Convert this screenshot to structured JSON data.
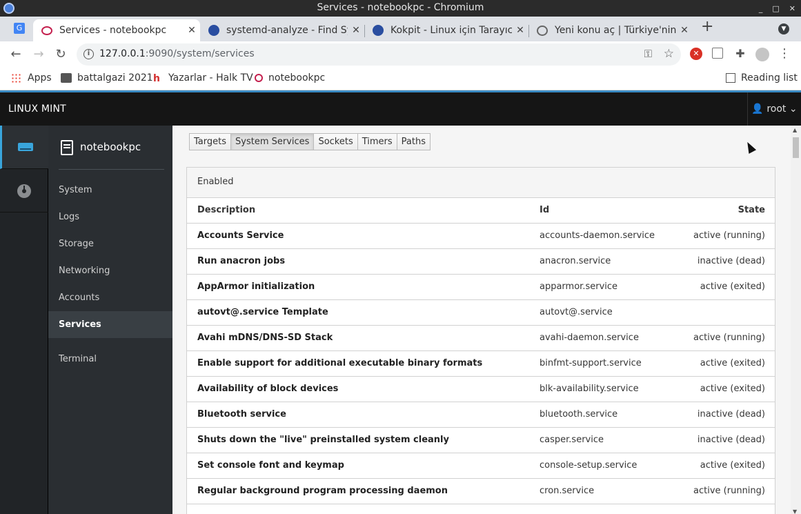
{
  "window": {
    "title": "Services - notebookpc - Chromium",
    "controls": [
      "_",
      "□",
      "✕"
    ]
  },
  "tabs": [
    {
      "label": "Services - notebookpc",
      "close": "✕"
    },
    {
      "label": "systemd-analyze - Find Syste",
      "close": "✕"
    },
    {
      "label": "Kokpit - Linux için Tarayıcı Ta",
      "close": "✕"
    },
    {
      "label": "Yeni konu aç | Türkiye'nin En",
      "close": "✕"
    }
  ],
  "newtab": "+",
  "toolbar": {
    "back": "←",
    "forward": "→",
    "reload": "↻",
    "info": "i",
    "url_host": "127.0.0.1",
    "url_rest": ":9090/system/services",
    "key": "⚿",
    "star": "☆",
    "menu": "⋮"
  },
  "bookmarks": {
    "apps": "Apps",
    "b1": "battalgazi 2021",
    "b2": "Yazarlar - Halk TV",
    "b3": "notebookpc",
    "reading_list": "Reading list"
  },
  "cockpit": {
    "brand": "LINUX MINT",
    "user": "root",
    "host": "notebookpc",
    "nav": [
      "System",
      "Logs",
      "Storage",
      "Networking",
      "Accounts",
      "Services",
      "Terminal"
    ],
    "tabs": [
      "Targets",
      "System Services",
      "Sockets",
      "Timers",
      "Paths"
    ],
    "section": "Enabled",
    "columns": {
      "description": "Description",
      "id": "Id",
      "state": "State"
    },
    "rows": [
      {
        "description": "Accounts Service",
        "id": "accounts-daemon.service",
        "state": "active (running)"
      },
      {
        "description": "Run anacron jobs",
        "id": "anacron.service",
        "state": "inactive (dead)"
      },
      {
        "description": "AppArmor initialization",
        "id": "apparmor.service",
        "state": "active (exited)"
      },
      {
        "description": "autovt@.service Template",
        "id": "autovt@.service",
        "state": ""
      },
      {
        "description": "Avahi mDNS/DNS-SD Stack",
        "id": "avahi-daemon.service",
        "state": "active (running)"
      },
      {
        "description": "Enable support for additional executable binary formats",
        "id": "binfmt-support.service",
        "state": "active (exited)"
      },
      {
        "description": "Availability of block devices",
        "id": "blk-availability.service",
        "state": "active (exited)"
      },
      {
        "description": "Bluetooth service",
        "id": "bluetooth.service",
        "state": "inactive (dead)"
      },
      {
        "description": "Shuts down the \"live\" preinstalled system cleanly",
        "id": "casper.service",
        "state": "inactive (dead)"
      },
      {
        "description": "Set console font and keymap",
        "id": "console-setup.service",
        "state": "active (exited)"
      },
      {
        "description": "Regular background program processing daemon",
        "id": "cron.service",
        "state": "active (running)"
      }
    ]
  },
  "colors": {
    "accent": "#39a5dc",
    "masthead": "#151515",
    "nav": "#2a2e32"
  }
}
